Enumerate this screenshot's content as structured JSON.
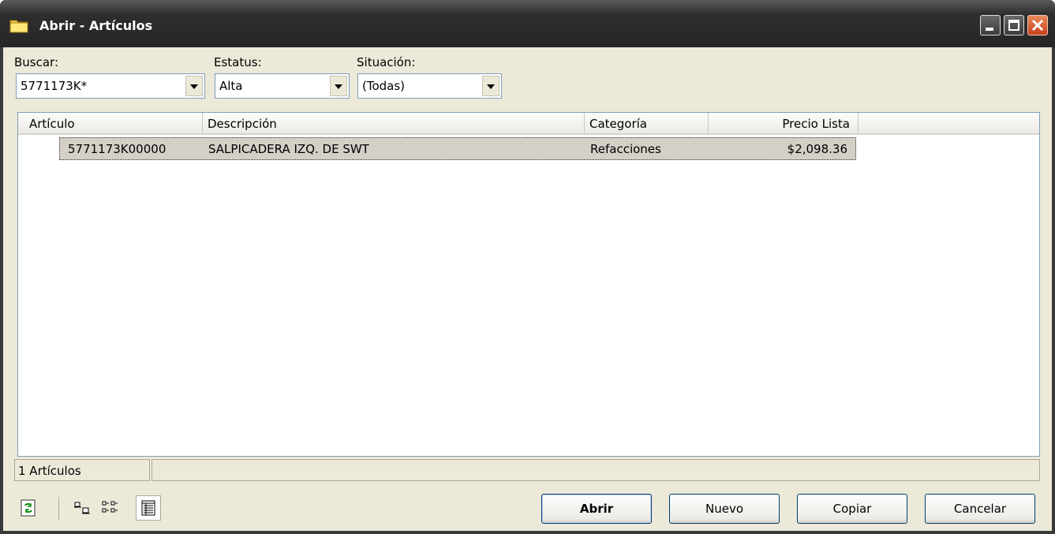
{
  "window": {
    "title": "Abrir - Artículos"
  },
  "filters": {
    "buscar": {
      "label": "Buscar:",
      "value": "5771173K*"
    },
    "estatus": {
      "label": "Estatus:",
      "value": "Alta"
    },
    "situacion": {
      "label": "Situación:",
      "value": "(Todas)"
    }
  },
  "table": {
    "columns": [
      "Artículo",
      "Descripción",
      "Categoría",
      "Precio Lista"
    ],
    "rows": [
      {
        "articulo": "5771173K00000",
        "descripcion": "SALPICADERA IZQ. DE SWT",
        "categoria": "Refacciones",
        "precio": "$2,098.36"
      }
    ]
  },
  "status": {
    "count": "1 Artículos"
  },
  "toolbar_icons": [
    "refresh-icon",
    "small-icons-view-icon",
    "list-view-icon",
    "details-view-icon"
  ],
  "buttons": {
    "open": "Abrir",
    "new": "Nuevo",
    "copy": "Copiar",
    "cancel": "Cancelar"
  }
}
